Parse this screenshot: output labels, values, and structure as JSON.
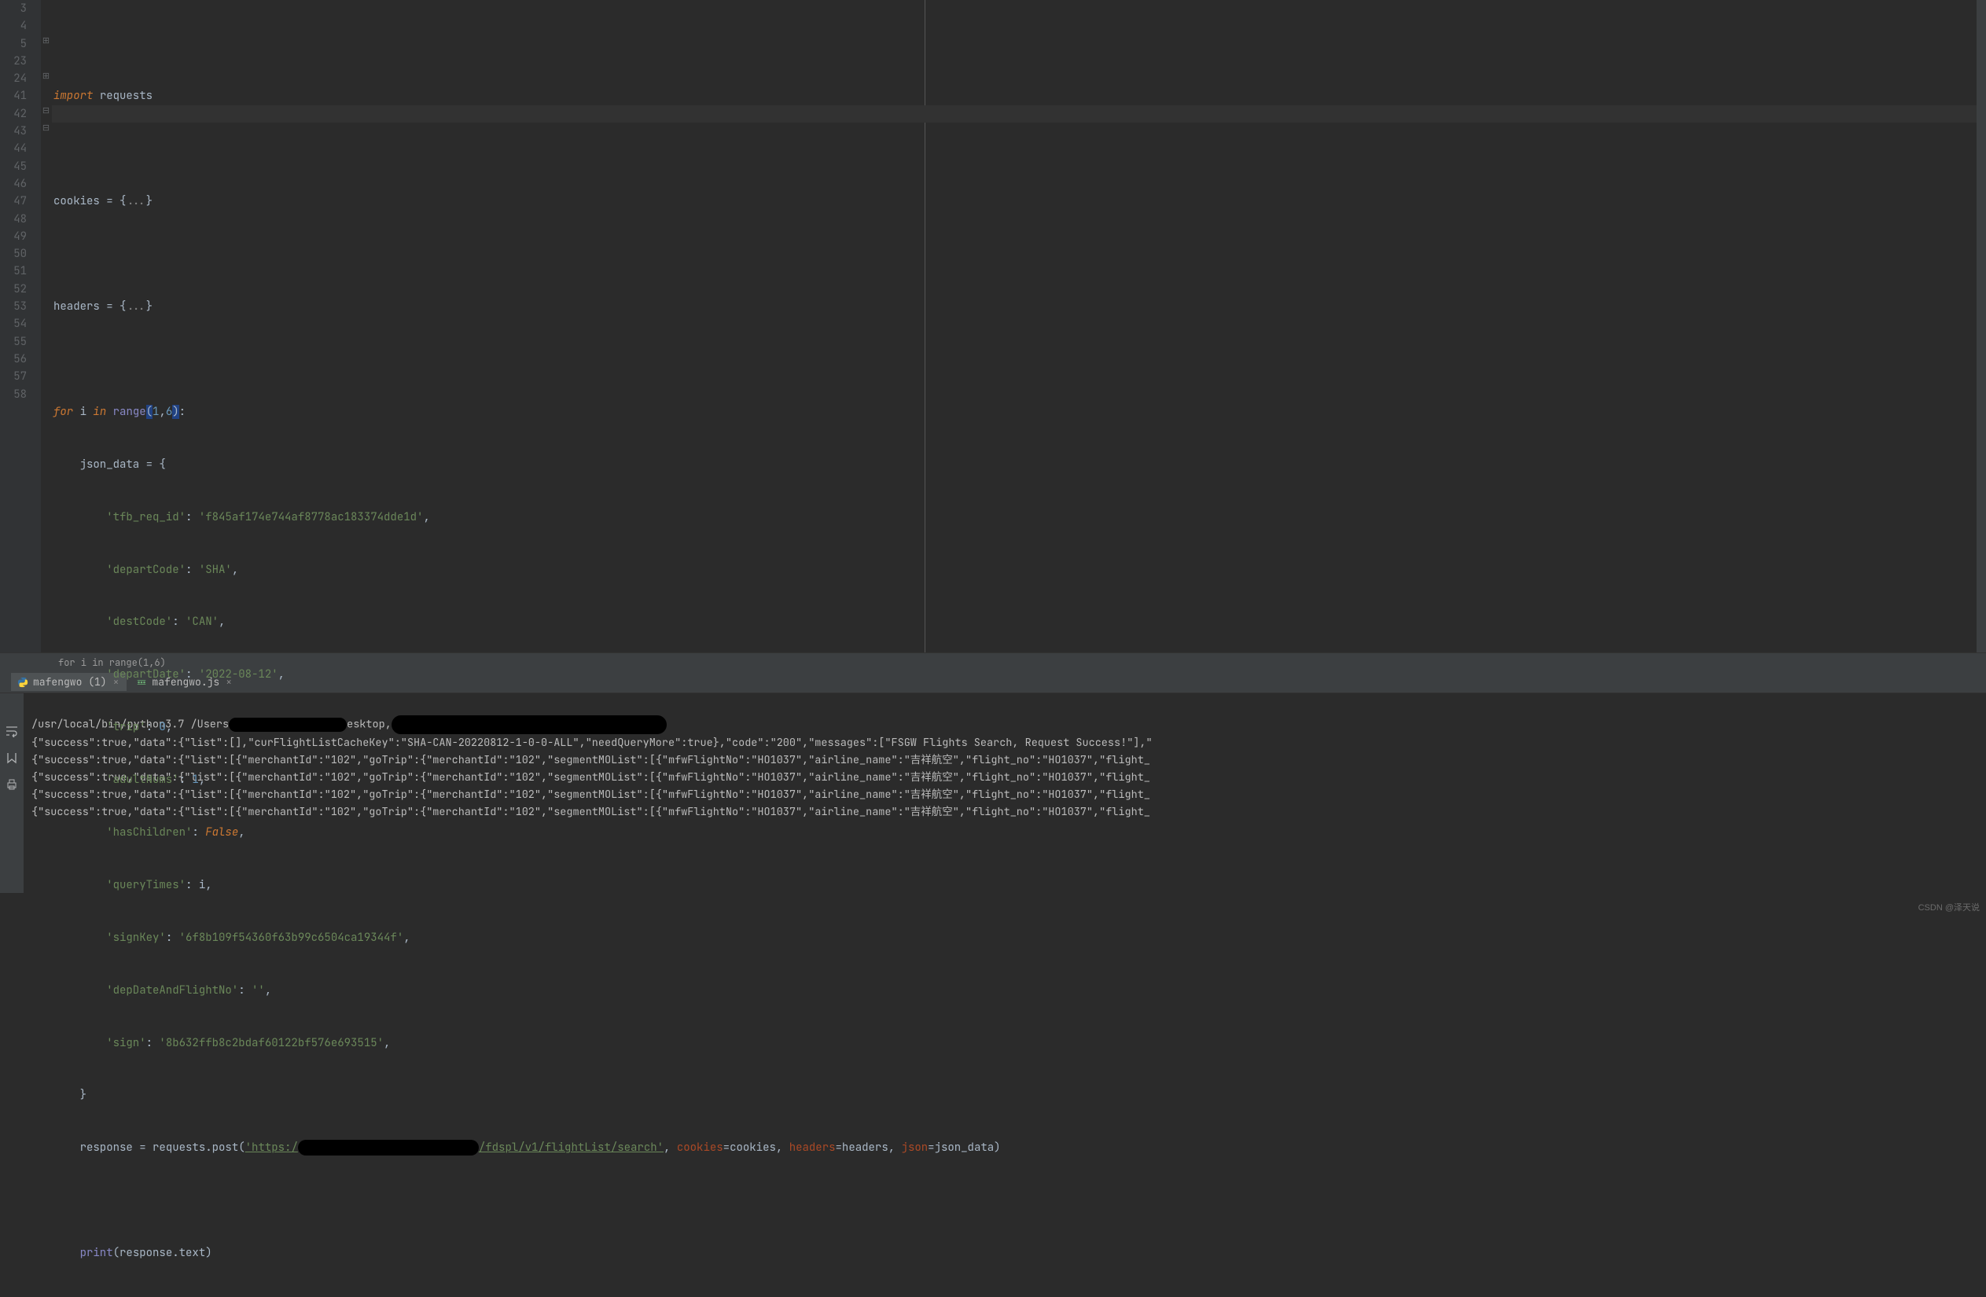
{
  "gutter": [
    "3",
    "4",
    "5",
    "23",
    "24",
    "41",
    "42",
    "43",
    "44",
    "45",
    "46",
    "47",
    "48",
    "49",
    "50",
    "51",
    "52",
    "53",
    "54",
    "55",
    "56",
    "57",
    "58"
  ],
  "code": {
    "l3": {
      "kw": "import",
      "mod": "requests"
    },
    "l5": {
      "var": "cookies",
      "eq": " = {",
      "fold": "...",
      "close": "}"
    },
    "l24": {
      "var": "headers",
      "eq": " = {",
      "fold": "...",
      "close": "}"
    },
    "l42": {
      "for": "for",
      "i": "i",
      "in": "in",
      "range": "range",
      "open": "(",
      "a": "1",
      "comma": ",",
      "b": "6",
      "close": ")",
      ":": ":"
    },
    "l43": {
      "indent": "    ",
      "var": "json_data",
      "eq": " = {"
    },
    "l44": {
      "indent": "        ",
      "k": "'tfb_req_id'",
      "sep": ": ",
      "v": "'f845af174e744af8778ac183374dde1d'",
      "c": ","
    },
    "l45": {
      "indent": "        ",
      "k": "'departCode'",
      "sep": ": ",
      "v": "'SHA'",
      "c": ","
    },
    "l46": {
      "indent": "        ",
      "k": "'destCode'",
      "sep": ": ",
      "v": "'CAN'",
      "c": ","
    },
    "l47": {
      "indent": "        ",
      "k": "'departDate'",
      "sep": ": ",
      "v": "'2022-08-12'",
      "c": ","
    },
    "l48": {
      "indent": "        ",
      "k": "'trip'",
      "sep": ": ",
      "v": "0",
      "c": ","
    },
    "l49": {
      "indent": "        ",
      "k": "'adultNums'",
      "sep": ": ",
      "v": "1",
      "c": ","
    },
    "l50": {
      "indent": "        ",
      "k": "'hasChildren'",
      "sep": ": ",
      "v": "False",
      "c": ","
    },
    "l51": {
      "indent": "        ",
      "k": "'queryTimes'",
      "sep": ": ",
      "v": "i",
      "c": ","
    },
    "l52": {
      "indent": "        ",
      "k": "'signKey'",
      "sep": ": ",
      "v": "'6f8b109f54360f63b99c6504ca19344f'",
      "c": ","
    },
    "l53": {
      "indent": "        ",
      "k": "'depDateAndFlightNo'",
      "sep": ": ",
      "v": "''",
      "c": ","
    },
    "l54": {
      "indent": "        ",
      "k": "'sign'",
      "sep": ": ",
      "v": "'8b632ffb8c2bdaf60122bf576e693515'",
      "c": ","
    },
    "l55": {
      "indent": "    ",
      "close": "}"
    },
    "l56": {
      "indent": "    ",
      "var": "response",
      "eq": " = ",
      "obj": "requests",
      "dot": ".",
      "fn": "post",
      "open": "(",
      "url1": "'https:/",
      "url2": "/fdspl/v1/flightList/search'",
      "sep1": ", ",
      "p1": "cookies",
      "e1": "=",
      "a1": "cookies",
      "sep2": ", ",
      "p2": "headers",
      "e2": "=",
      "a2": "headers",
      "sep3": ", ",
      "p3": "json",
      "e3": "=",
      "a3": "json_data",
      "close": ")"
    },
    "l58": {
      "indent": "    ",
      "fn": "print",
      "open": "(",
      "arg": "response.text",
      "close": ")"
    }
  },
  "breadcrumb": "for i in range(1,6)",
  "tabs": [
    {
      "label": "mafengwo (1)",
      "type": "py",
      "active": true
    },
    {
      "label": "mafengwo.js",
      "type": "js",
      "active": false
    }
  ],
  "console": {
    "cmd_prefix": "/usr/local/bin/python3.7 /Users",
    "cmd_suffix": "esktop,",
    "line1": "{\"success\":true,\"data\":{\"list\":[],\"curFlightListCacheKey\":\"SHA-CAN-20220812-1-0-0-ALL\",\"needQueryMore\":true},\"code\":\"200\",\"messages\":[\"FSGW Flights Search, Request Success!\"],\"",
    "line_repeat": "{\"success\":true,\"data\":{\"list\":[{\"merchantId\":\"102\",\"goTrip\":{\"merchantId\":\"102\",\"segmentMOList\":[{\"mfwFlightNo\":\"HO1037\",\"airline_name\":\"吉祥航空\",\"flight_no\":\"HO1037\",\"flight_"
  },
  "watermark": "CSDN @泽天说"
}
